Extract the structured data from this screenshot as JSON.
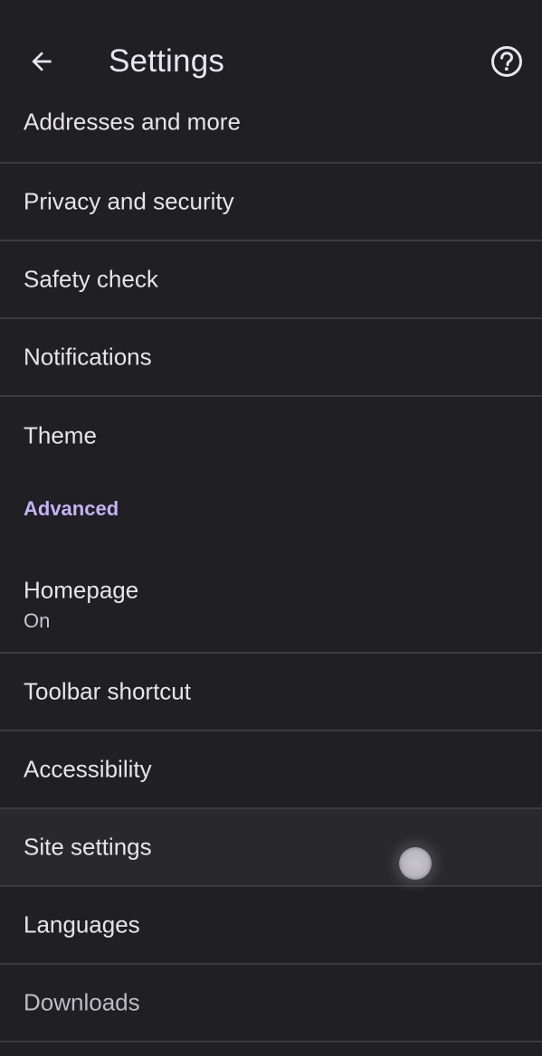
{
  "appbar": {
    "title": "Settings",
    "back_icon": "arrow-back-icon",
    "help_icon": "help-circle-icon"
  },
  "settings": {
    "addresses": "Addresses and more",
    "privacy": "Privacy and security",
    "safety_check": "Safety check",
    "notifications": "Notifications",
    "theme": "Theme",
    "advanced_header": "Advanced",
    "homepage": "Homepage",
    "homepage_status": "On",
    "toolbar_shortcut": "Toolbar shortcut",
    "accessibility": "Accessibility",
    "site_settings": "Site settings",
    "languages": "Languages",
    "downloads": "Downloads"
  },
  "colors": {
    "background": "#1f1f24",
    "divider": "#3b3a40",
    "accent": "#c3b5f5",
    "text": "#e6e4ea"
  }
}
